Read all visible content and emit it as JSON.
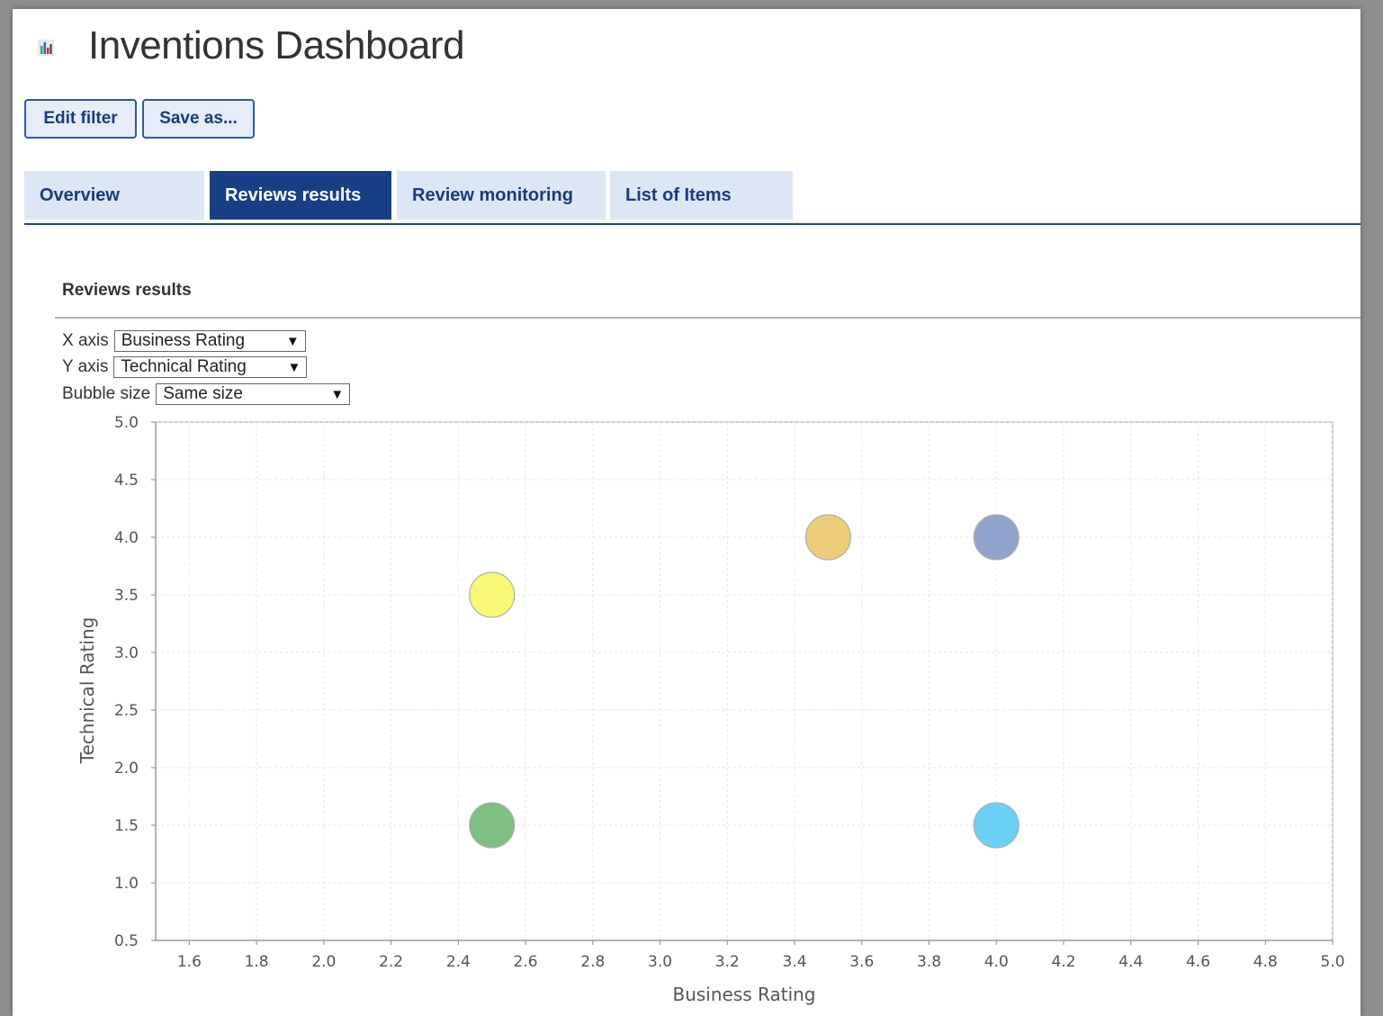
{
  "app": {
    "title": "Inventions Dashboard",
    "icon": "bar-chart-icon"
  },
  "toolbar": {
    "edit_filter_label": "Edit filter",
    "save_as_label": "Save as..."
  },
  "tabs": [
    {
      "label": "Overview",
      "active": false
    },
    {
      "label": "Reviews results",
      "active": true
    },
    {
      "label": "Review monitoring",
      "active": false
    },
    {
      "label": "List of Items",
      "active": false
    }
  ],
  "section": {
    "title": "Reviews results"
  },
  "controls": {
    "x_axis": {
      "label": "X axis",
      "value": "Business Rating"
    },
    "y_axis": {
      "label": "Y axis",
      "value": "Technical Rating"
    },
    "bubble_size": {
      "label": "Bubble size",
      "value": "Same size"
    }
  },
  "colors": {
    "accent": "#163f86",
    "tab_bg": "#dde6f5",
    "bubbles": [
      "#f7f765",
      "#e9c868",
      "#8499c6",
      "#6fb973",
      "#5bcbf5"
    ]
  },
  "chart_data": {
    "type": "scatter",
    "xlabel": "Business Rating",
    "ylabel": "Technical Rating",
    "xlim": [
      1.5,
      5.0
    ],
    "ylim": [
      0.5,
      5.0
    ],
    "x_ticks": [
      "1.6",
      "1.8",
      "2.0",
      "2.2",
      "2.4",
      "2.6",
      "2.8",
      "3.0",
      "3.2",
      "3.4",
      "3.6",
      "3.8",
      "4.0",
      "4.2",
      "4.4",
      "4.6",
      "4.8",
      "5.0"
    ],
    "y_ticks": [
      "0.5",
      "1.0",
      "1.5",
      "2.0",
      "2.5",
      "3.0",
      "3.5",
      "4.0",
      "4.5",
      "5.0"
    ],
    "grid": true,
    "points": [
      {
        "x": 2.5,
        "y": 3.5,
        "color": "#f7f765"
      },
      {
        "x": 3.5,
        "y": 4.0,
        "color": "#e9c868"
      },
      {
        "x": 4.0,
        "y": 4.0,
        "color": "#8499c6"
      },
      {
        "x": 2.5,
        "y": 1.5,
        "color": "#6fb973"
      },
      {
        "x": 4.0,
        "y": 1.5,
        "color": "#5bcbf5"
      }
    ]
  }
}
